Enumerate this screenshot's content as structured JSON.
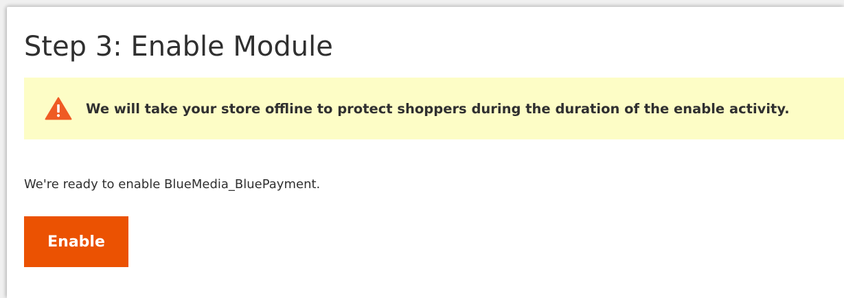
{
  "page": {
    "title": "Step 3: Enable Module"
  },
  "notice": {
    "icon": "warning-triangle-icon",
    "icon_color": "#ef5b24",
    "background": "#fdfdc6",
    "message": "We will take your store offline to protect shoppers during the duration of the enable activity."
  },
  "content": {
    "ready_message": "We're ready to enable BlueMedia_BluePayment."
  },
  "actions": {
    "enable_label": "Enable",
    "enable_color": "#eb5202"
  }
}
